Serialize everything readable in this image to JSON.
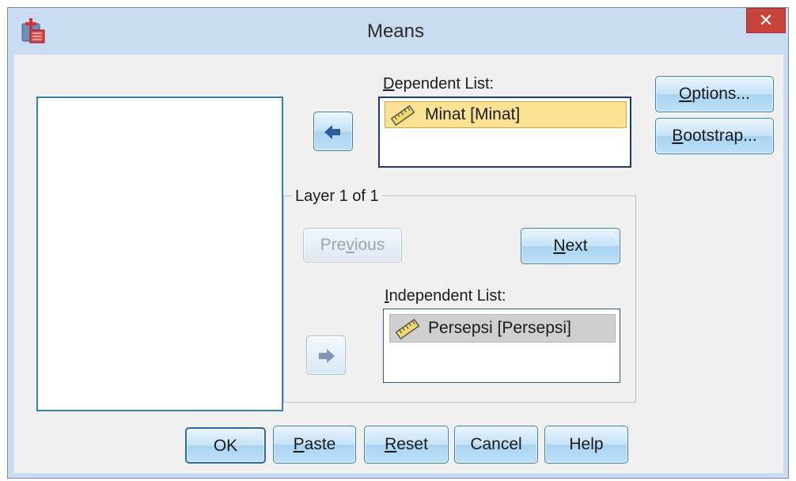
{
  "window": {
    "title": "Means",
    "close_glyph": "✕"
  },
  "source_list": {
    "items": []
  },
  "dependent": {
    "label_prefix": "",
    "label_mnemonic": "D",
    "label_rest": "ependent List:",
    "items": [
      {
        "text": "Minat [Minat]",
        "icon": "scale-ruler-icon"
      }
    ]
  },
  "layer": {
    "legend": "Layer 1 of 1",
    "previous": {
      "pre": "Pre",
      "mnemonic": "v",
      "post": "ious",
      "enabled": false
    },
    "next": {
      "mnemonic": "N",
      "post": "ext",
      "enabled": true
    }
  },
  "independent": {
    "label_mnemonic": "I",
    "label_rest": "ndependent List:",
    "items": [
      {
        "text": "Persepsi [Persepsi]",
        "icon": "scale-ruler-icon"
      }
    ]
  },
  "side_buttons": {
    "options": {
      "mnemonic": "O",
      "post": "ptions..."
    },
    "bootstrap": {
      "mnemonic": "B",
      "post": "ootstrap..."
    }
  },
  "bottom_buttons": {
    "ok": "OK",
    "paste": {
      "mnemonic": "P",
      "post": "aste"
    },
    "reset": {
      "mnemonic": "R",
      "post": "eset"
    },
    "cancel": "Cancel",
    "help": "Help"
  },
  "colors": {
    "frame": "#c9dcf2",
    "selected_item": "#fbe292",
    "inactive_item": "#cfcfcf",
    "close": "#c7443a"
  }
}
